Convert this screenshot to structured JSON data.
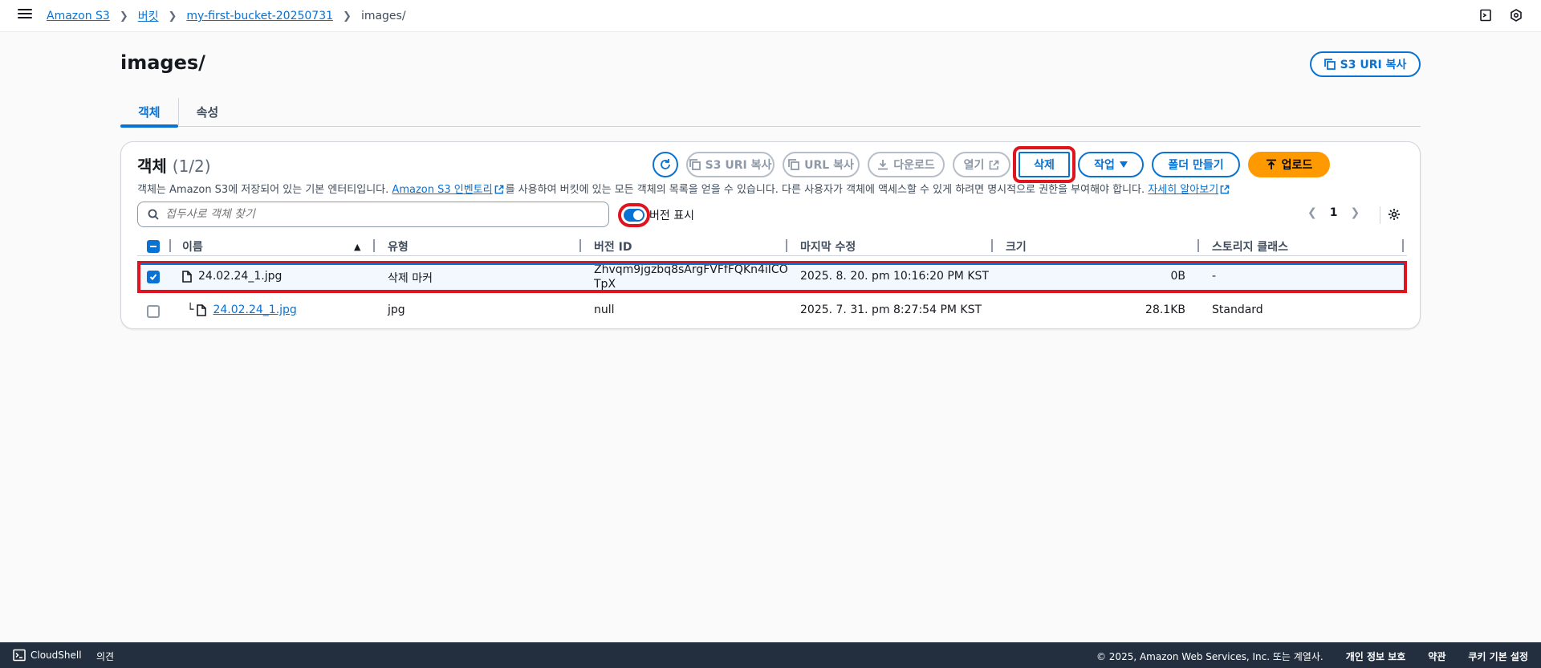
{
  "breadcrumb": {
    "items": [
      "Amazon S3",
      "버킷",
      "my-first-bucket-20250731"
    ],
    "current": "images/"
  },
  "header": {
    "title": "images/",
    "copy_uri_label": "S3 URI 복사"
  },
  "tabs": [
    "객체",
    "속성"
  ],
  "objects_panel": {
    "title": "객체",
    "count": "(1/2)",
    "description_prefix": "객체는 Amazon S3에 저장되어 있는 기본 엔터티입니다.",
    "inventory_link": "Amazon S3 인벤토리",
    "description_mid": "를 사용하여 버킷에 있는 모든 객체의 목록을 얻을 수 있습니다. 다른 사용자가 객체에 액세스할 수 있게 하려면 명시적으로 권한을 부여해야 합니다.",
    "learn_more": "자세히 알아보기",
    "toolbar": {
      "copy_s3_uri": "S3 URI 복사",
      "copy_url": "URL 복사",
      "download": "다운로드",
      "open": "열기",
      "delete": "삭제",
      "actions": "작업",
      "create_folder": "폴더 만들기",
      "upload": "업로드"
    },
    "search_placeholder": "접두사로 객체 찾기",
    "show_versions_label": "버전 표시",
    "page": "1",
    "columns": [
      "이름",
      "유형",
      "버전 ID",
      "마지막 수정",
      "크기",
      "스토리지 클래스"
    ],
    "rows": [
      {
        "name": "24.02.24_1.jpg",
        "type": "삭제 마커",
        "version_id_line1": "Zhvqm9jgzbq8sArgFVFfFQKn4iICO",
        "version_id_line2": "TpX",
        "last_modified": "2025. 8. 20. pm 10:16:20 PM KST",
        "size": "0B",
        "storage_class": "-"
      },
      {
        "name": "24.02.24_1.jpg",
        "type": "jpg",
        "version_id": "null",
        "last_modified": "2025. 7. 31. pm 8:27:54 PM KST",
        "size": "28.1KB",
        "storage_class": "Standard"
      }
    ]
  },
  "footer": {
    "cloudshell": "CloudShell",
    "feedback": "의견",
    "copyright": "© 2025, Amazon Web Services, Inc. 또는 계열사.",
    "privacy": "개인 정보 보호",
    "terms": "약관",
    "cookies": "쿠키 기본 설정"
  },
  "colors": {
    "accent": "#0972d3",
    "upload": "#ff9900",
    "highlight": "#e0141e",
    "footer_bg": "#232f3e"
  }
}
